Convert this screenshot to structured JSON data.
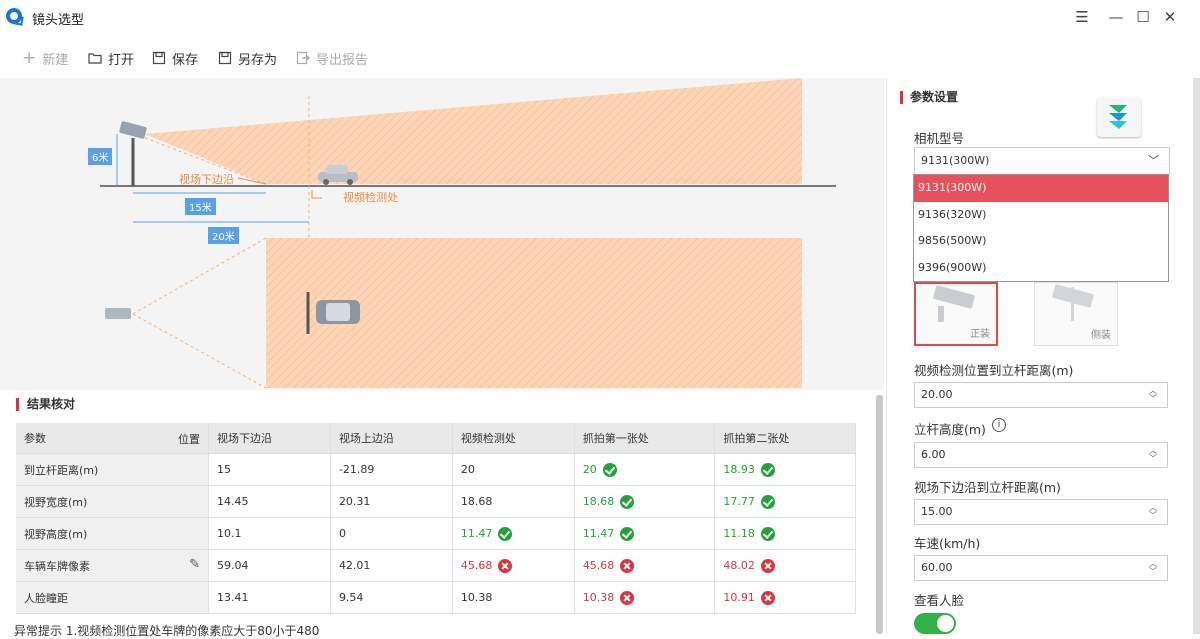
{
  "window": {
    "title": "镜头选型"
  },
  "toolbar": {
    "new": "新建",
    "open": "打开",
    "save": "保存",
    "save_as": "另存为",
    "export": "导出报告"
  },
  "diagram": {
    "height_label": "6米",
    "fov_lower_label": "视场下边沿",
    "detect_label": "视频检测处",
    "dist1_label": "15米",
    "dist2_label": "20米"
  },
  "results": {
    "title": "结果核对",
    "corner_param": "参数",
    "corner_pos": "位置",
    "columns": [
      "视场下边沿",
      "视场上边沿",
      "视频检测处",
      "抓拍第一张处",
      "抓拍第二张处"
    ],
    "rows": [
      {
        "name": "到立杆距离(m)",
        "cells": [
          {
            "v": "15",
            "s": ""
          },
          {
            "v": "-21.89",
            "s": ""
          },
          {
            "v": "20",
            "s": ""
          },
          {
            "v": "20",
            "s": "ok"
          },
          {
            "v": "18.93",
            "s": "ok"
          }
        ]
      },
      {
        "name": "视野宽度(m)",
        "cells": [
          {
            "v": "14.45",
            "s": ""
          },
          {
            "v": "20.31",
            "s": ""
          },
          {
            "v": "18.68",
            "s": ""
          },
          {
            "v": "18.68",
            "s": "ok"
          },
          {
            "v": "17.77",
            "s": "ok"
          }
        ]
      },
      {
        "name": "视野高度(m)",
        "cells": [
          {
            "v": "10.1",
            "s": ""
          },
          {
            "v": "0",
            "s": ""
          },
          {
            "v": "11.47",
            "s": "ok"
          },
          {
            "v": "11.47",
            "s": "ok"
          },
          {
            "v": "11.18",
            "s": "ok"
          }
        ]
      },
      {
        "name": "车辆车牌像素",
        "cells": [
          {
            "v": "59.04",
            "s": ""
          },
          {
            "v": "42.01",
            "s": ""
          },
          {
            "v": "45.68",
            "s": "bad"
          },
          {
            "v": "45.68",
            "s": "bad"
          },
          {
            "v": "48.02",
            "s": "bad"
          }
        ]
      },
      {
        "name": "人脸瞳距",
        "cells": [
          {
            "v": "13.41",
            "s": ""
          },
          {
            "v": "9.54",
            "s": ""
          },
          {
            "v": "10.38",
            "s": ""
          },
          {
            "v": "10.38",
            "s": "bad"
          },
          {
            "v": "10.91",
            "s": "bad"
          }
        ]
      }
    ],
    "hint": "异常提示  1.视频检测位置处车牌的像素应大于80小于480"
  },
  "params": {
    "title": "参数设置",
    "camera_model_label": "相机型号",
    "camera_model_value": "9131(300W)",
    "camera_options": [
      "9131(300W)",
      "9136(320W)",
      "9856(500W)",
      "9396(900W)"
    ],
    "mount_front": "正装",
    "mount_side": "侧装",
    "detect_dist_label": "视频检测位置到立杆距离(m)",
    "detect_dist_value": "20.00",
    "pole_height_label": "立杆高度(m)",
    "pole_height_value": "6.00",
    "fov_lower_dist_label": "视场下边沿到立杆距离(m)",
    "fov_lower_dist_value": "15.00",
    "speed_label": "车速(km/h)",
    "speed_value": "60.00",
    "face_label": "查看人脸",
    "face_on": true
  },
  "colors": {
    "accent": "#e0303a",
    "ok": "#22a43a",
    "bad": "#d9363e",
    "fov": "#fdd6b8",
    "label_blue": "#5aa0e6"
  }
}
